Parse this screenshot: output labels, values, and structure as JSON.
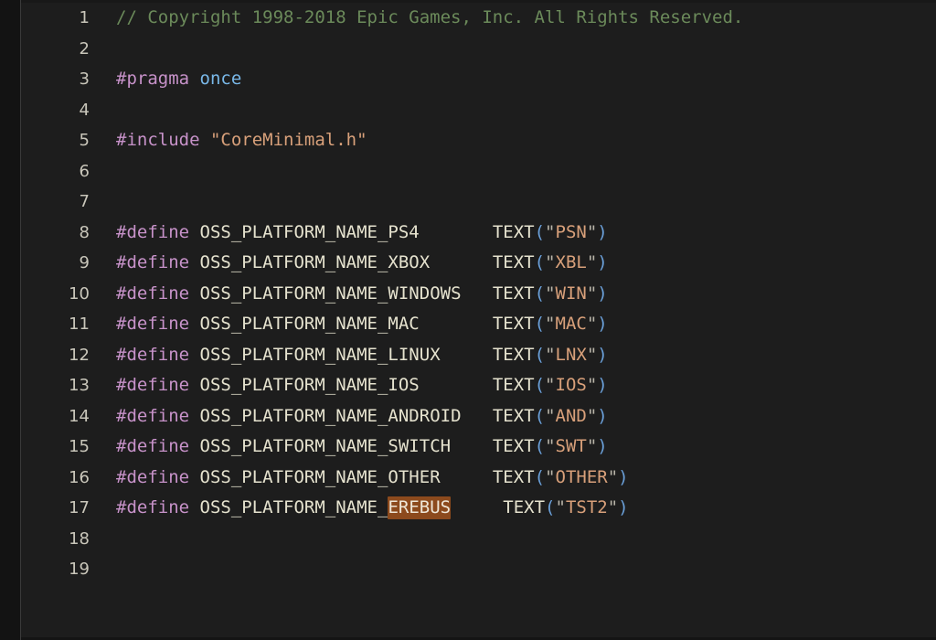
{
  "editor": {
    "theme_name": "dark",
    "colors": {
      "background": "#1d1d1d",
      "gutter_strip": "#131313",
      "line_number": "#c9c6ba",
      "comment": "#6b8a5a",
      "preprocessor": "#c792c9",
      "keyword": "#79b8e8",
      "string": "#d8a07a",
      "identifier": "#e6e3cf",
      "paren": "#6a9fd8",
      "selection_highlight": "#8c4a1d"
    },
    "lines": [
      {
        "number": "1",
        "tokens": [
          {
            "text": "// Copyright 1998-2018 Epic Games, Inc. All Rights Reserved.",
            "kind": "comment"
          }
        ]
      },
      {
        "number": "2",
        "tokens": []
      },
      {
        "number": "3",
        "tokens": [
          {
            "text": "#pragma",
            "kind": "pp"
          },
          {
            "text": " ",
            "kind": "plain"
          },
          {
            "text": "once",
            "kind": "kw"
          }
        ]
      },
      {
        "number": "4",
        "tokens": []
      },
      {
        "number": "5",
        "tokens": [
          {
            "text": "#include",
            "kind": "pp"
          },
          {
            "text": " ",
            "kind": "plain"
          },
          {
            "text": "\"CoreMinimal.h\"",
            "kind": "string"
          }
        ]
      },
      {
        "number": "6",
        "tokens": []
      },
      {
        "number": "7",
        "tokens": []
      },
      {
        "number": "8",
        "tokens": [
          {
            "text": "#define",
            "kind": "pp"
          },
          {
            "text": " ",
            "kind": "plain"
          },
          {
            "text": "OSS_PLATFORM_NAME_PS4",
            "kind": "ident"
          },
          {
            "text": "       ",
            "kind": "plain"
          },
          {
            "text": "TEXT",
            "kind": "fn"
          },
          {
            "text": "(",
            "kind": "paren"
          },
          {
            "text": "\"",
            "kind": "quote"
          },
          {
            "text": "PSN",
            "kind": "string"
          },
          {
            "text": "\"",
            "kind": "quote"
          },
          {
            "text": ")",
            "kind": "paren"
          }
        ]
      },
      {
        "number": "9",
        "tokens": [
          {
            "text": "#define",
            "kind": "pp"
          },
          {
            "text": " ",
            "kind": "plain"
          },
          {
            "text": "OSS_PLATFORM_NAME_XBOX",
            "kind": "ident"
          },
          {
            "text": "      ",
            "kind": "plain"
          },
          {
            "text": "TEXT",
            "kind": "fn"
          },
          {
            "text": "(",
            "kind": "paren"
          },
          {
            "text": "\"",
            "kind": "quote"
          },
          {
            "text": "XBL",
            "kind": "string"
          },
          {
            "text": "\"",
            "kind": "quote"
          },
          {
            "text": ")",
            "kind": "paren"
          }
        ]
      },
      {
        "number": "10",
        "tokens": [
          {
            "text": "#define",
            "kind": "pp"
          },
          {
            "text": " ",
            "kind": "plain"
          },
          {
            "text": "OSS_PLATFORM_NAME_WINDOWS",
            "kind": "ident"
          },
          {
            "text": "   ",
            "kind": "plain"
          },
          {
            "text": "TEXT",
            "kind": "fn"
          },
          {
            "text": "(",
            "kind": "paren"
          },
          {
            "text": "\"",
            "kind": "quote"
          },
          {
            "text": "WIN",
            "kind": "string"
          },
          {
            "text": "\"",
            "kind": "quote"
          },
          {
            "text": ")",
            "kind": "paren"
          }
        ]
      },
      {
        "number": "11",
        "tokens": [
          {
            "text": "#define",
            "kind": "pp"
          },
          {
            "text": " ",
            "kind": "plain"
          },
          {
            "text": "OSS_PLATFORM_NAME_MAC",
            "kind": "ident"
          },
          {
            "text": "       ",
            "kind": "plain"
          },
          {
            "text": "TEXT",
            "kind": "fn"
          },
          {
            "text": "(",
            "kind": "paren"
          },
          {
            "text": "\"",
            "kind": "quote"
          },
          {
            "text": "MAC",
            "kind": "string"
          },
          {
            "text": "\"",
            "kind": "quote"
          },
          {
            "text": ")",
            "kind": "paren"
          }
        ]
      },
      {
        "number": "12",
        "tokens": [
          {
            "text": "#define",
            "kind": "pp"
          },
          {
            "text": " ",
            "kind": "plain"
          },
          {
            "text": "OSS_PLATFORM_NAME_LINUX",
            "kind": "ident"
          },
          {
            "text": "     ",
            "kind": "plain"
          },
          {
            "text": "TEXT",
            "kind": "fn"
          },
          {
            "text": "(",
            "kind": "paren"
          },
          {
            "text": "\"",
            "kind": "quote"
          },
          {
            "text": "LNX",
            "kind": "string"
          },
          {
            "text": "\"",
            "kind": "quote"
          },
          {
            "text": ")",
            "kind": "paren"
          }
        ]
      },
      {
        "number": "13",
        "tokens": [
          {
            "text": "#define",
            "kind": "pp"
          },
          {
            "text": " ",
            "kind": "plain"
          },
          {
            "text": "OSS_PLATFORM_NAME_IOS",
            "kind": "ident"
          },
          {
            "text": "       ",
            "kind": "plain"
          },
          {
            "text": "TEXT",
            "kind": "fn"
          },
          {
            "text": "(",
            "kind": "paren"
          },
          {
            "text": "\"",
            "kind": "quote"
          },
          {
            "text": "IOS",
            "kind": "string"
          },
          {
            "text": "\"",
            "kind": "quote"
          },
          {
            "text": ")",
            "kind": "paren"
          }
        ]
      },
      {
        "number": "14",
        "tokens": [
          {
            "text": "#define",
            "kind": "pp"
          },
          {
            "text": " ",
            "kind": "plain"
          },
          {
            "text": "OSS_PLATFORM_NAME_ANDROID",
            "kind": "ident"
          },
          {
            "text": "   ",
            "kind": "plain"
          },
          {
            "text": "TEXT",
            "kind": "fn"
          },
          {
            "text": "(",
            "kind": "paren"
          },
          {
            "text": "\"",
            "kind": "quote"
          },
          {
            "text": "AND",
            "kind": "string"
          },
          {
            "text": "\"",
            "kind": "quote"
          },
          {
            "text": ")",
            "kind": "paren"
          }
        ]
      },
      {
        "number": "15",
        "tokens": [
          {
            "text": "#define",
            "kind": "pp"
          },
          {
            "text": " ",
            "kind": "plain"
          },
          {
            "text": "OSS_PLATFORM_NAME_SWITCH",
            "kind": "ident"
          },
          {
            "text": "    ",
            "kind": "plain"
          },
          {
            "text": "TEXT",
            "kind": "fn"
          },
          {
            "text": "(",
            "kind": "paren"
          },
          {
            "text": "\"",
            "kind": "quote"
          },
          {
            "text": "SWT",
            "kind": "string"
          },
          {
            "text": "\"",
            "kind": "quote"
          },
          {
            "text": ")",
            "kind": "paren"
          }
        ]
      },
      {
        "number": "16",
        "tokens": [
          {
            "text": "#define",
            "kind": "pp"
          },
          {
            "text": " ",
            "kind": "plain"
          },
          {
            "text": "OSS_PLATFORM_NAME_OTHER",
            "kind": "ident"
          },
          {
            "text": "     ",
            "kind": "plain"
          },
          {
            "text": "TEXT",
            "kind": "fn"
          },
          {
            "text": "(",
            "kind": "paren"
          },
          {
            "text": "\"",
            "kind": "quote"
          },
          {
            "text": "OTHER",
            "kind": "string"
          },
          {
            "text": "\"",
            "kind": "quote"
          },
          {
            "text": ")",
            "kind": "paren"
          }
        ]
      },
      {
        "number": "17",
        "tokens": [
          {
            "text": "#define",
            "kind": "pp"
          },
          {
            "text": " ",
            "kind": "plain"
          },
          {
            "text": "OSS_PLATFORM_NAME_",
            "kind": "ident"
          },
          {
            "text": "EREBUS",
            "kind": "ident-highlight"
          },
          {
            "text": "     ",
            "kind": "plain"
          },
          {
            "text": "TEXT",
            "kind": "fn"
          },
          {
            "text": "(",
            "kind": "paren"
          },
          {
            "text": "\"",
            "kind": "quote"
          },
          {
            "text": "TST2",
            "kind": "string"
          },
          {
            "text": "\"",
            "kind": "quote"
          },
          {
            "text": ")",
            "kind": "paren"
          }
        ]
      },
      {
        "number": "18",
        "tokens": []
      },
      {
        "number": "19",
        "tokens": []
      }
    ]
  }
}
